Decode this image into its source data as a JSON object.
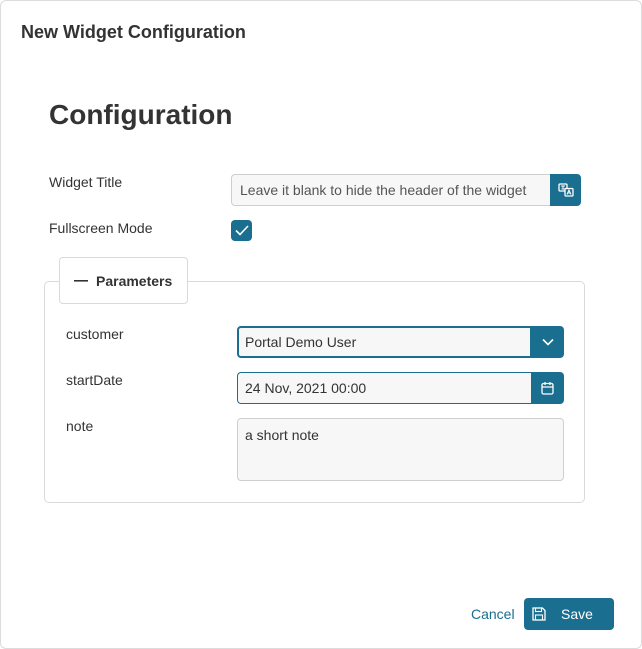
{
  "dialog": {
    "title": "New Widget Configuration"
  },
  "section": {
    "heading": "Configuration"
  },
  "widget_title": {
    "label": "Widget Title",
    "placeholder": "Leave it blank to hide the header of the widget",
    "addon_icon": "translate-icon"
  },
  "fullscreen": {
    "label": "Fullscreen Mode",
    "checked": true
  },
  "parameters": {
    "legend": "Parameters",
    "collapse_icon": "minus-icon",
    "customer": {
      "label": "customer",
      "value": "Portal Demo User",
      "icon": "chevron-down-icon"
    },
    "start_date": {
      "label": "startDate",
      "value": "24 Nov, 2021 00:00",
      "icon": "calendar-icon"
    },
    "note": {
      "label": "note",
      "value": "a short note"
    }
  },
  "footer": {
    "cancel_label": "Cancel",
    "save_label": "Save",
    "save_icon": "floppy-disk-icon"
  },
  "colors": {
    "accent": "#1a6e8f",
    "input_background": "#f7f7f7",
    "border": "#d9d9d9"
  }
}
